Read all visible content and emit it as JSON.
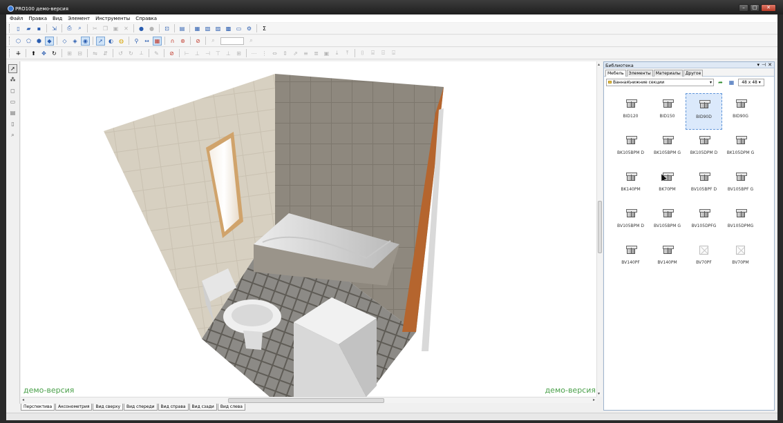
{
  "window": {
    "title": "PRO100 демо-версия"
  },
  "menu": [
    "Файл",
    "Правка",
    "Вид",
    "Элемент",
    "Инструменты",
    "Справка"
  ],
  "viewport": {
    "watermark": "демо-версия"
  },
  "view_tabs": [
    "Перспектива",
    "Аксонометрия",
    "Вид сверху",
    "Вид спереди",
    "Вид справа",
    "Вид сзади",
    "Вид слева"
  ],
  "library": {
    "title": "Библиотека",
    "tabs": [
      "Мебель",
      "Элементы",
      "Материалы",
      "Другое"
    ],
    "path": "Ванная\\нижние секции",
    "thumb_size": "48 x 48",
    "items": [
      {
        "label": "BID120",
        "type": "cabinet"
      },
      {
        "label": "BID150",
        "type": "cabinet"
      },
      {
        "label": "BID90D",
        "type": "cabinet",
        "selected": true
      },
      {
        "label": "BID90G",
        "type": "cabinet"
      },
      {
        "label": "BK105BPM D",
        "type": "cabinet"
      },
      {
        "label": "BK105BPM G",
        "type": "cabinet"
      },
      {
        "label": "BK105DPM D",
        "type": "cabinet"
      },
      {
        "label": "BK105DPM G",
        "type": "cabinet"
      },
      {
        "label": "BK140PM",
        "type": "cabinet"
      },
      {
        "label": "BK70PM",
        "type": "cabinet"
      },
      {
        "label": "BV105BPF D",
        "type": "cabinet"
      },
      {
        "label": "BV105BPF G",
        "type": "cabinet"
      },
      {
        "label": "BV105BPM D",
        "type": "cabinet"
      },
      {
        "label": "BV105BPM G",
        "type": "cabinet"
      },
      {
        "label": "BV105DPFG",
        "type": "cabinet"
      },
      {
        "label": "BV105DPMG",
        "type": "cabinet"
      },
      {
        "label": "BV140PF",
        "type": "cabinet"
      },
      {
        "label": "BV140PM",
        "type": "cabinet"
      },
      {
        "label": "BV70PF",
        "type": "empty"
      },
      {
        "label": "BV70PM",
        "type": "empty"
      }
    ]
  },
  "colors": {
    "watermark": "#4aa04a",
    "selection": "#dbe9fb"
  }
}
